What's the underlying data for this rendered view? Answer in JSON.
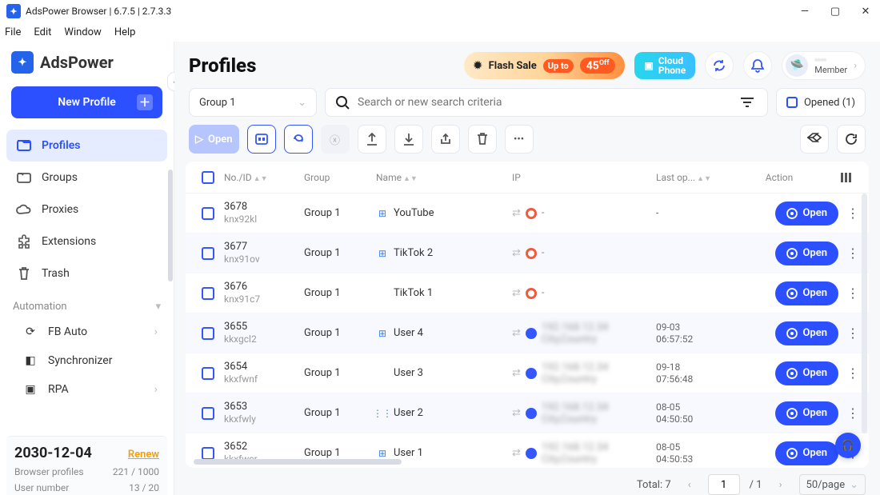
{
  "window": {
    "title": "AdsPower Browser | 6.7.5 | 2.7.3.3"
  },
  "menubar": [
    "File",
    "Edit",
    "Window",
    "Help"
  ],
  "brand": "AdsPower",
  "new_profile": "New Profile",
  "nav": [
    {
      "label": "Profiles",
      "active": true
    },
    {
      "label": "Groups"
    },
    {
      "label": "Proxies"
    },
    {
      "label": "Extensions"
    },
    {
      "label": "Trash"
    }
  ],
  "automation_label": "Automation",
  "automation": [
    {
      "label": "FB Auto"
    },
    {
      "label": "Synchronizer"
    },
    {
      "label": "RPA"
    }
  ],
  "footer": {
    "date": "2030-12-04",
    "renew": "Renew",
    "bp_label": "Browser profiles",
    "bp_val": "221 / 1000",
    "un_label": "User number",
    "un_val": "13 / 20"
  },
  "page_title": "Profiles",
  "flash": {
    "l1": "Flash Sale",
    "l2": "Up to",
    "pct": "45",
    "off": "Off"
  },
  "cloud": {
    "l1": "Cloud",
    "l2": "Phone"
  },
  "member": {
    "role": "Member",
    "name_masked": "••••"
  },
  "group_sel": "Group 1",
  "search_ph": "Search or new search criteria",
  "opened": "Opened (1)",
  "open_label": "Open",
  "columns": {
    "no": "No./ID",
    "group": "Group",
    "name": "Name",
    "ip": "IP",
    "last": "Last op...",
    "action": "Action"
  },
  "rows": [
    {
      "no": "3678",
      "id": "knx92kl",
      "group": "Group 1",
      "os": "win",
      "name": "YouTube",
      "ip_kind": "warn",
      "ip": "-",
      "last": "-"
    },
    {
      "no": "3677",
      "id": "knx91ov",
      "group": "Group 1",
      "os": "win",
      "name": "TikTok 2",
      "ip_kind": "warn",
      "ip": "-",
      "last": ""
    },
    {
      "no": "3676",
      "id": "knx91c7",
      "group": "Group 1",
      "os": "mac",
      "name": "TikTok 1",
      "ip_kind": "warn",
      "ip": "-",
      "last": ""
    },
    {
      "no": "3655",
      "id": "kkxgcl2",
      "group": "Group 1",
      "os": "win",
      "name": "User 4",
      "ip_kind": "ok",
      "ip": "masked",
      "last": "09-03\n06:57:52"
    },
    {
      "no": "3654",
      "id": "kkxfwnf",
      "group": "Group 1",
      "os": "mac",
      "name": "User 3",
      "ip_kind": "ok",
      "ip": "masked",
      "last": "09-18\n07:56:48"
    },
    {
      "no": "3653",
      "id": "kkxfwly",
      "group": "Group 1",
      "os": "and",
      "name": "User 2",
      "ip_kind": "ok",
      "ip": "masked",
      "last": "08-05\n04:50:50"
    },
    {
      "no": "3652",
      "id": "kkxfwcr",
      "group": "Group 1",
      "os": "win",
      "name": "User 1",
      "ip_kind": "ok",
      "ip": "masked",
      "last": "08-05\n04:50:53"
    }
  ],
  "pager": {
    "total_label": "Total: 7",
    "page": "1",
    "pages": "/ 1",
    "per": "50/page"
  }
}
